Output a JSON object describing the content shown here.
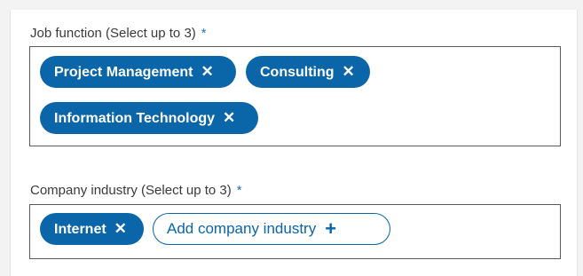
{
  "job_function": {
    "label": "Job function (Select up to 3)",
    "required_mark": "*",
    "selected": [
      {
        "label": "Project Management",
        "remove_icon": "✕"
      },
      {
        "label": "Consulting",
        "remove_icon": "✕"
      },
      {
        "label": "Information Technology",
        "remove_icon": "✕"
      }
    ]
  },
  "company_industry": {
    "label": "Company industry (Select up to 3)",
    "required_mark": "*",
    "selected": [
      {
        "label": "Internet",
        "remove_icon": "✕"
      }
    ],
    "add_button_label": "Add company industry",
    "add_icon": "+"
  },
  "colors": {
    "accent": "#0a66a8",
    "required": "#2a73b8"
  }
}
